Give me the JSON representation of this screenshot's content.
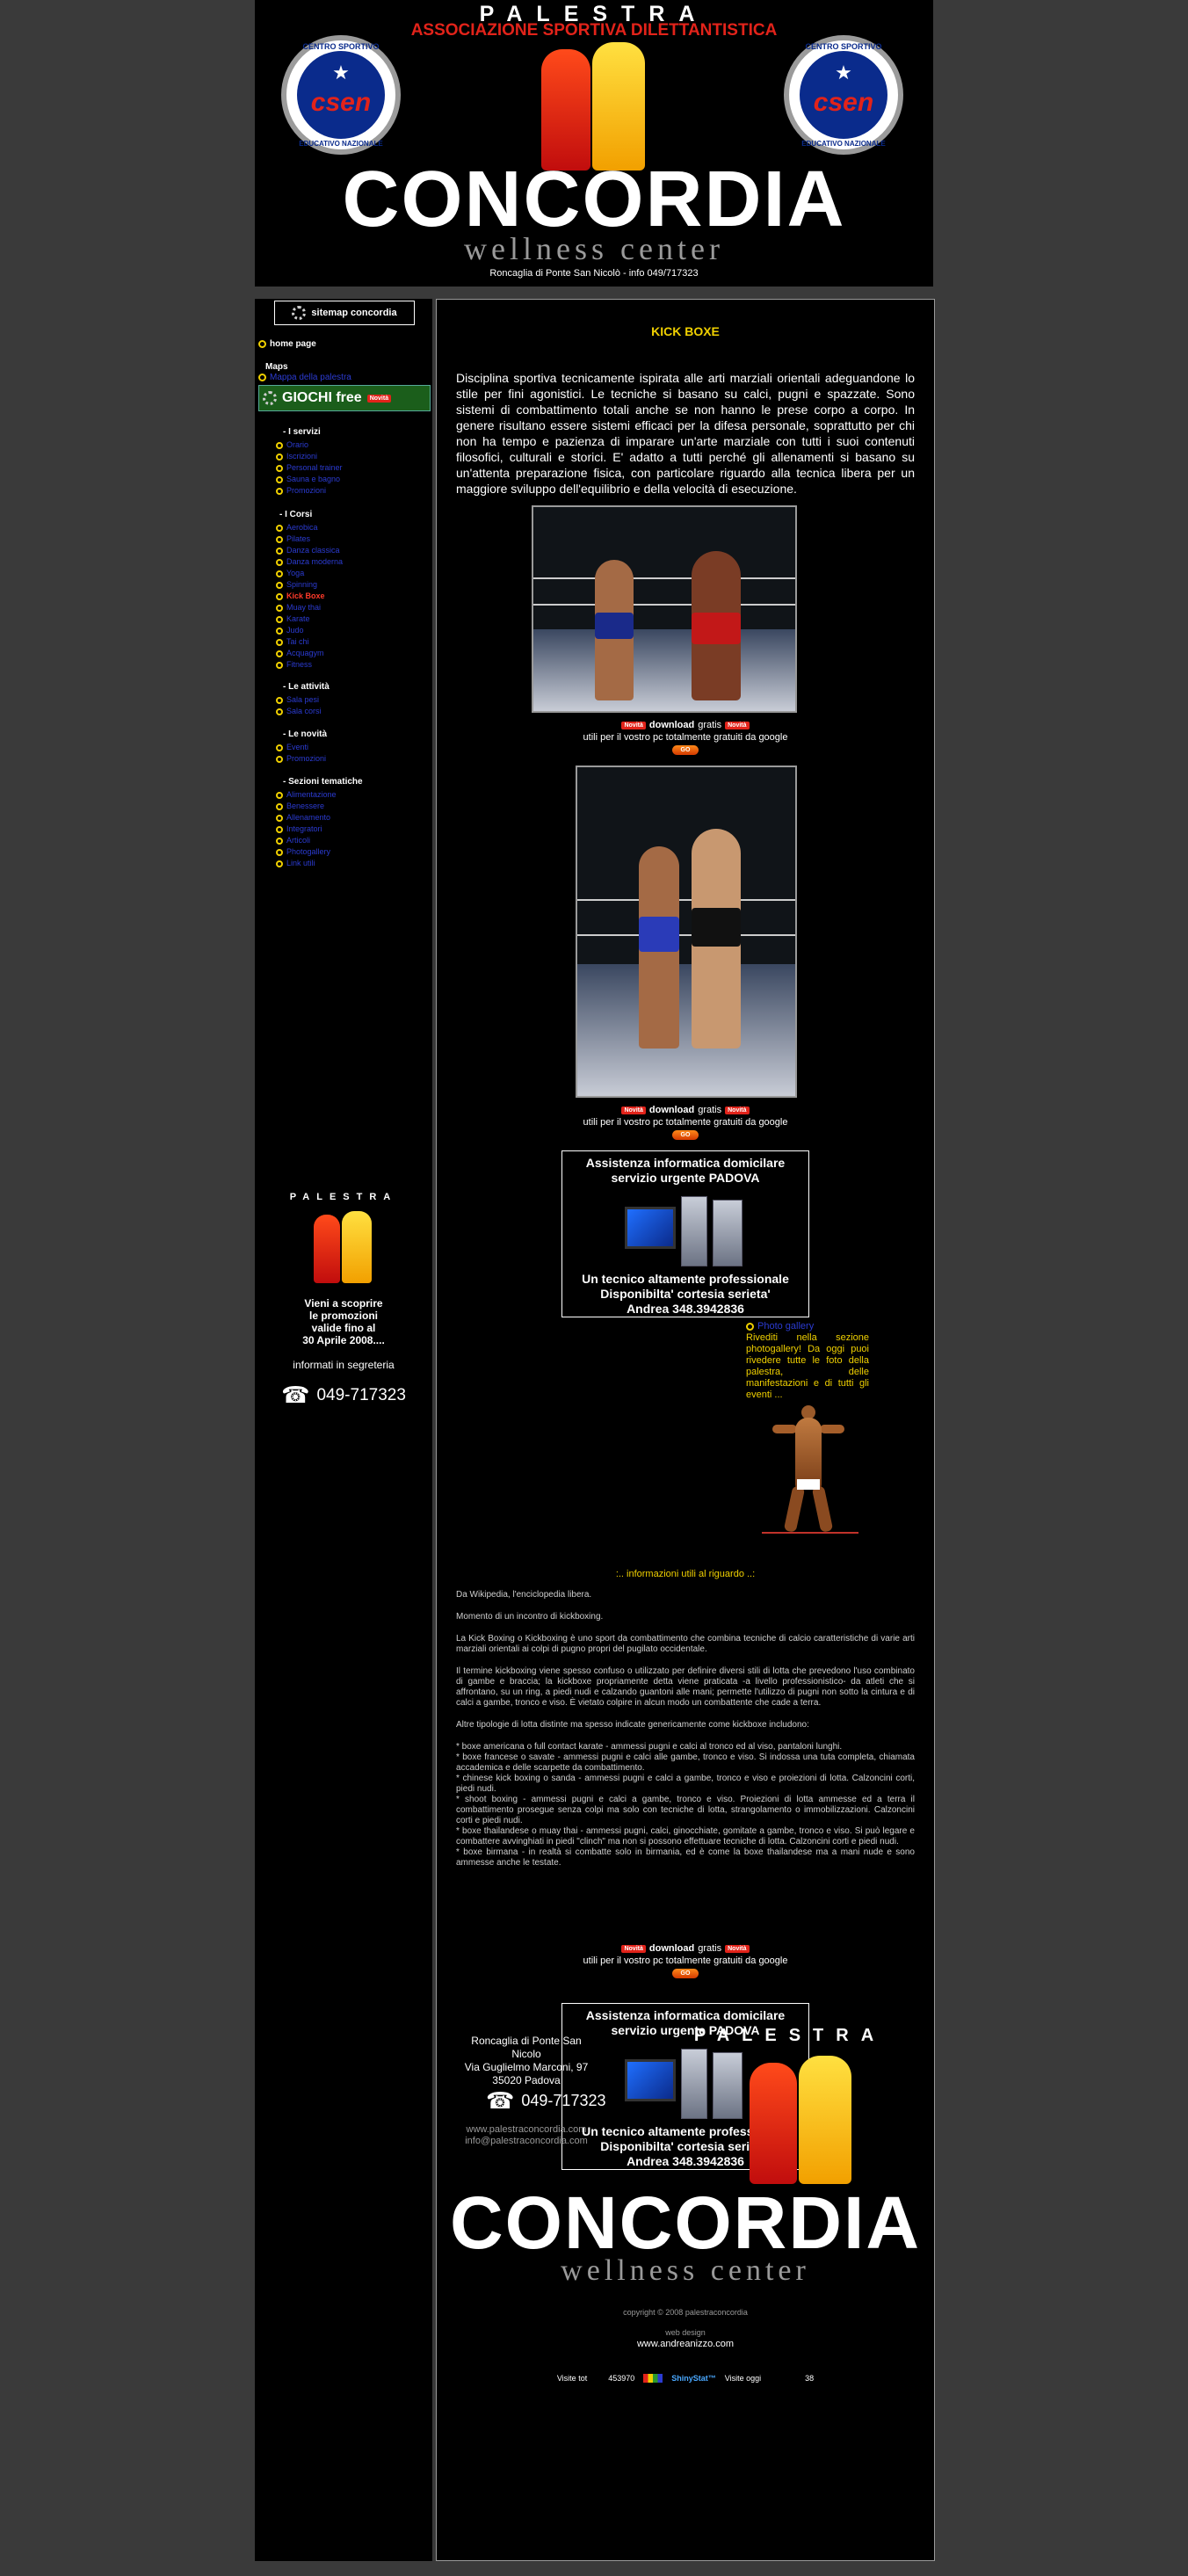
{
  "header": {
    "palestra": "PALESTRA",
    "assoc": "ASSOCIAZIONE SPORTIVA DILETTANTISTICA",
    "seal_text": "csen",
    "seal_top": "CENTRO SPORTIVO",
    "seal_bottom": "EDUCATIVO NAZIONALE",
    "title": "CONCORDIA",
    "subtitle": "wellness center",
    "address": "Roncaglia di Ponte San Nicolò - info 049/717323"
  },
  "sidebar": {
    "sitemap": "sitemap concordia",
    "home": "home page",
    "maps_head": "Maps",
    "maps_link": "Mappa della palestra",
    "giochi": "GIOCHI free",
    "badge": "Novità",
    "servizi_head": "- I servizi",
    "servizi": [
      "Orario",
      "Iscrizioni",
      "Personal trainer",
      "Sauna e bagno",
      "Promozioni"
    ],
    "corsi_head": "- I Corsi",
    "corsi": [
      "Aerobica",
      "Pilates",
      "Danza classica",
      "Danza moderna",
      "Yoga",
      "Spinning",
      "Kick boxe",
      "Muay thai",
      "Karate",
      "Judo",
      "Tai chi",
      "Acquagym",
      "Fitness"
    ],
    "corsi_active": "Kick Boxe",
    "attivita_head": "- Le attività",
    "attivita": [
      "Sala pesi",
      "Sala corsi"
    ],
    "novita_head": "- Le novità",
    "novita": [
      "Eventi",
      "Promozioni"
    ],
    "tematiche_head": "- Sezioni tematiche",
    "tematiche": [
      "Alimentazione",
      "Benessere",
      "Allenamento",
      "Integratori",
      "Articoli",
      "Photogallery",
      "Link utili"
    ],
    "promo_palestra": "PALESTRA",
    "promo_lines": [
      "Vieni a scoprire",
      "le promozioni",
      "valide fino al",
      "30 Aprile 2008...."
    ],
    "promo_info": "informati in segreteria",
    "phone": "049-717323"
  },
  "main": {
    "title": "KICK BOXE",
    "intro": "Disciplina sportiva tecnicamente ispirata alle arti marziali orientali adeguandone lo stile per fini agonistici. Le tecniche si basano su calci, pugni e spazzate. Sono sistemi di combattimento totali anche se non hanno le prese  corpo a corpo. In genere risultano essere sistemi efficaci per la difesa personale, soprattutto per chi non ha tempo e pazienza di imparare un'arte marziale con tutti i suoi contenuti filosofici, culturali e storici. E' adatto a tutti perché gli allenamenti si basano su un'attenta preparazione fisica, con particolare riguardo alla tecnica libera per un maggiore sviluppo dell'equilibrio e della velocità di esecuzione.",
    "download": {
      "novita": "Novità",
      "word": "download",
      "gratis": "gratis",
      "line2": "utili per il vostro pc totalmente gratuiti da google",
      "btn": "GO"
    },
    "ad": {
      "t1": "Assistenza informatica domicilare",
      "t2": "servizio urgente PADOVA",
      "b1": "Un tecnico altamente professionale",
      "b2": "Disponibilta' cortesia serieta'",
      "b3": "Andrea 348.3942836"
    },
    "photogallery": {
      "link": "Photo gallery",
      "text": "Rivediti nella sezione photogallery! Da oggi puoi rivedere tutte le foto della palestra, delle manifestazioni e di tutti gli eventi ..."
    },
    "info_title": ":.. informazioni utili al riguardo ..:",
    "wiki": [
      "Da Wikipedia, l'enciclopedia libera.",
      "Momento di un incontro di kickboxing.",
      "La Kick Boxing o Kickboxing è uno sport da combattimento che combina tecniche di calcio caratteristiche di varie arti marziali orientali ai colpi di pugno propri del pugilato occidentale.",
      "Il termine kickboxing viene spesso confuso o utilizzato per definire diversi stili di lotta che prevedono l'uso combinato di gambe e braccia; la kickboxe propriamente detta viene praticata -a livello professionistico- da atleti che si affrontano, su un ring, a piedi nudi e calzando guantoni alle mani; permette l'utilizzo di pugni non sotto la cintura e di calci a gambe, tronco e viso. È vietato colpire in alcun modo un combattente che cade a terra.",
      "Altre tipologie di lotta distinte ma spesso indicate genericamente come kickboxe includono:"
    ],
    "wiki_list": [
      "* boxe americana o full contact karate - ammessi pugni e calci al tronco ed al viso, pantaloni lunghi.",
      "* boxe francese o savate - ammessi pugni e calci alle gambe, tronco e viso. Si indossa una tuta completa, chiamata accademica e delle scarpette da combattimento.",
      "* chinese kick boxing o sanda - ammessi pugni e calci a gambe, tronco e viso e proiezioni di lotta. Calzoncini corti, piedi nudi.",
      "* shoot boxing - ammessi pugni e calci a gambe, tronco e viso. Proiezioni di lotta ammesse ed a terra il combattimento prosegue senza colpi ma solo con tecniche di lotta, strangolamento o immobilizzazioni. Calzoncini corti e piedi nudi.",
      "* boxe thailandese o muay thai - ammessi pugni, calci, ginocchiate, gomitate a gambe, tronco e viso. Si può legare e combattere avvinghiati in piedi \"clinch\" ma non si possono effettuare tecniche di lotta. Calzoncini corti e piedi nudi.",
      "* boxe birmana - in realtà si combatte solo in birmania, ed è come la boxe thailandese ma a mani nude e sono ammesse anche le testate."
    ]
  },
  "footer": {
    "addr": [
      "Roncaglia di Ponte San Nicolo",
      "Via Guglielmo Marconi, 97",
      "35020 Padova"
    ],
    "phone": "049-717323",
    "site": "www.palestraconcordia.com",
    "email": "info@palestraconcordia.com",
    "palestra": "PALESTRA",
    "title": "CONCORDIA",
    "subtitle": "wellness center",
    "copyright": "copyright © 2008 palestraconcordia",
    "webdesign": "web design",
    "webdesign_url": "www.andreanizzo.com",
    "visite_tot_label": "Visite tot",
    "visite_tot": "453970",
    "stat_logo": "ShinyStat™",
    "visite_oggi_label": "Visite oggi",
    "visite_oggi": "38"
  }
}
